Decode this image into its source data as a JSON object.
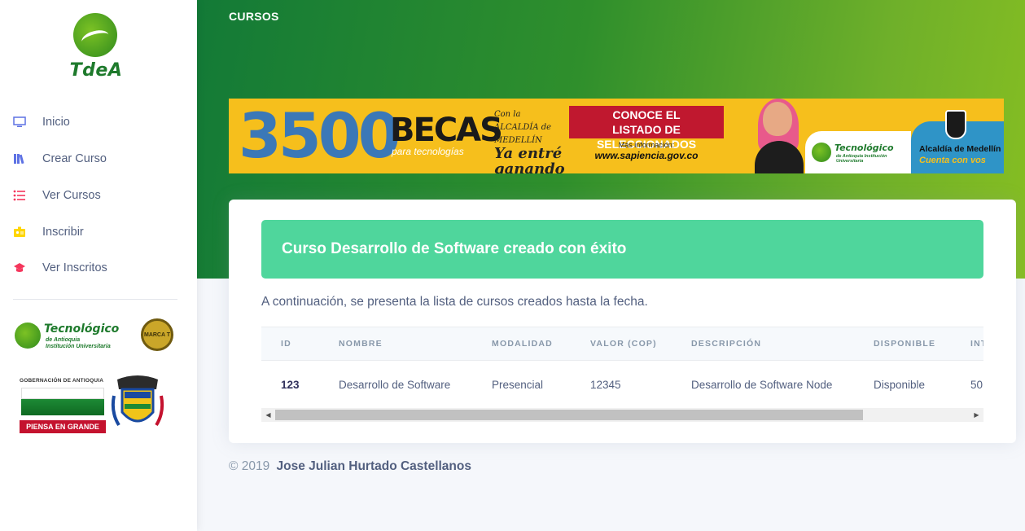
{
  "sidebar": {
    "logo_text": "TdeA",
    "items": [
      {
        "label": "Inicio",
        "icon": "monitor-icon",
        "color": "#5e72e4"
      },
      {
        "label": "Crear Curso",
        "icon": "books-icon",
        "color": "#5e72e4"
      },
      {
        "label": "Ver Cursos",
        "icon": "list-icon",
        "color": "#f5365c"
      },
      {
        "label": "Inscribir",
        "icon": "badge-icon",
        "color": "#ffd600"
      },
      {
        "label": "Ver Inscritos",
        "icon": "graduation-cap-icon",
        "color": "#f5365c"
      }
    ],
    "partner_logo": {
      "title": "Tecnológico",
      "subtitle_1": "de Antioquia",
      "subtitle_2": "Institución Universitaria",
      "seal": "MARCA T"
    },
    "gob_logo": {
      "title": "GOBERNACIÓN DE ANTIOQUIA",
      "slogan": "PIENSA EN GRANDE"
    }
  },
  "header": {
    "title": "CURSOS"
  },
  "banner": {
    "big_number": "3500",
    "becas": "BECAS",
    "becas_sub": "para tecnologías",
    "ya_entre_small": "Con la ALCALDÍA de MEDELLÍN",
    "ya_entre": "Ya entré ganando",
    "conoce_1": "CONOCE EL",
    "conoce_2": "LISTADO DE SELECCIONADOS",
    "mas_info": "Más información:",
    "url": "www.sapiencia.gov.co",
    "tda_name": "Tecnológico",
    "tda_sub": "de Antioquia Institución Universitaria",
    "alcaldia": "Alcaldía de Medellín",
    "cuenta": "Cuenta con vos"
  },
  "alert": {
    "text": "Curso Desarrollo de Software creado con éxito",
    "color": "#4fd69c"
  },
  "intro": "A continuación, se presenta la lista de cursos creados hasta la fecha.",
  "table": {
    "columns": [
      "ID",
      "NOMBRE",
      "MODALIDAD",
      "VALOR (COP)",
      "DESCRIPCIÓN",
      "DISPONIBLE",
      "INT"
    ],
    "rows": [
      [
        "123",
        "Desarrollo de Software",
        "Presencial",
        "12345",
        "Desarrollo de Software Node",
        "Disponible",
        "50"
      ]
    ]
  },
  "footer": {
    "copyright": "© 2019",
    "author": "Jose Julian Hurtado Castellanos"
  },
  "colors": {
    "header_gradient_start": "#137a37",
    "header_gradient_end": "#86be22",
    "banner_yellow": "#f6bf1c",
    "primary": "#5e72e4"
  }
}
